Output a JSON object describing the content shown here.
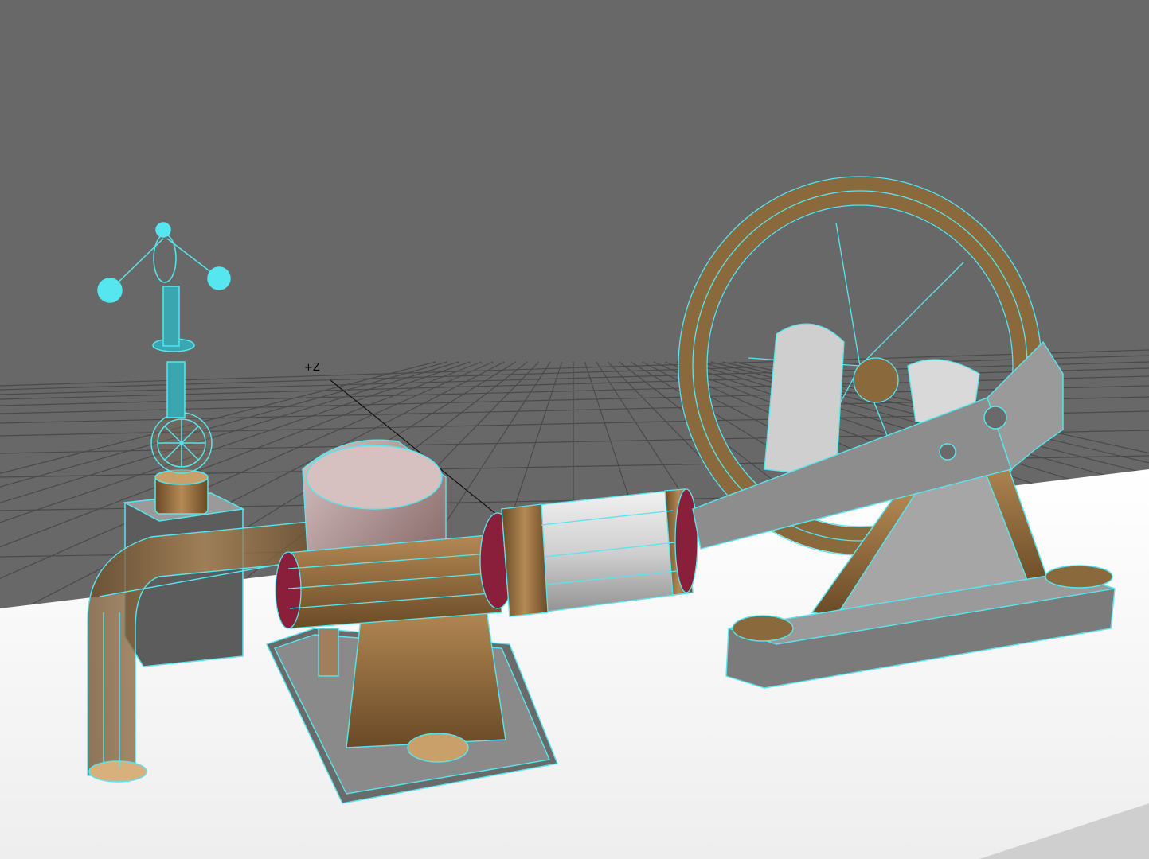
{
  "viewport": {
    "axis_label": "+Z",
    "background_color": "#686868",
    "grid_color": "#4a4a4a",
    "wireframe_color": "#55e6ef",
    "bronze_color": "#8a6a3c",
    "metal_color": "#c9c9c9",
    "floor_color": "#f4f4f4",
    "accent_red": "#8a1f3c"
  },
  "scene_objects": [
    "governor",
    "steam-pipe",
    "steam-cylinder",
    "cylinder-pedestal",
    "piston-rod",
    "crosshead-guide",
    "connecting-rod",
    "flywheel",
    "engine-frame",
    "base-plate"
  ]
}
